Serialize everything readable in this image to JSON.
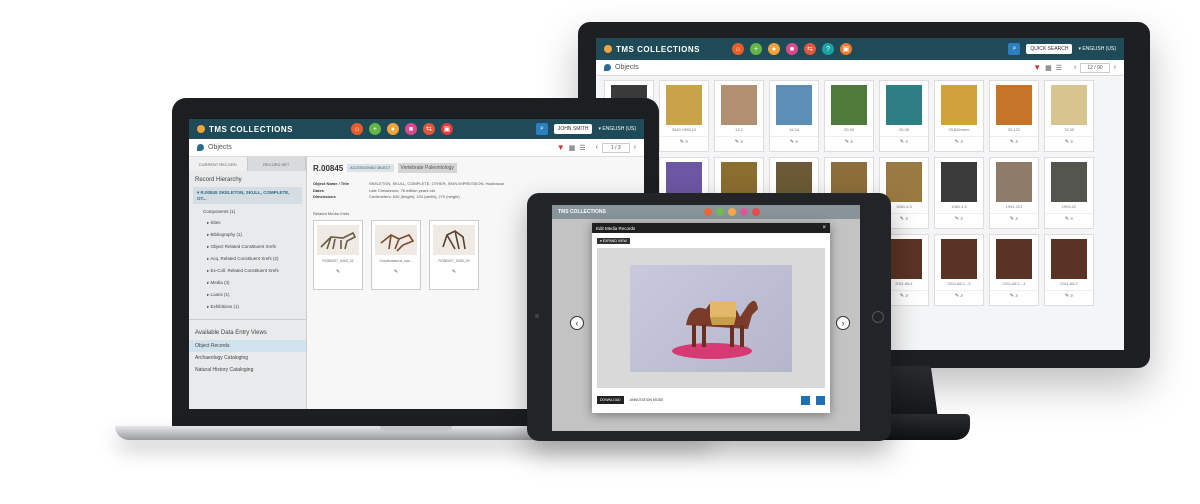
{
  "monitor": {
    "brand": "TMS COLLECTIONS",
    "user": "QUICK SEARCH",
    "lang": "▾ ENGLISH (US)",
    "page_title": "Objects",
    "pager": "12 / 90",
    "thumbs": [
      {
        "label": "",
        "color": "#3a3a3a"
      },
      {
        "label": "3040 1995.10",
        "color": "#c9a24a"
      },
      {
        "label": "13.2",
        "color": "#b09070"
      },
      {
        "label": "19.34",
        "color": "#5c8fb8"
      },
      {
        "label": "20.35",
        "color": "#4f7a3a"
      },
      {
        "label": "25.36",
        "color": "#2e7f83"
      },
      {
        "label": "29.83/mmm",
        "color": "#d1a23c"
      },
      {
        "label": "30.122",
        "color": "#c5752a"
      },
      {
        "label": "78.35",
        "color": "#d8c48e"
      },
      {
        "label": "",
        "color": "#7a4a3b"
      },
      {
        "label": "",
        "color": "#6c57a3"
      },
      {
        "label": "",
        "color": "#8a6d2f"
      },
      {
        "label": "",
        "color": "#6b5a35"
      },
      {
        "label": "1961.5",
        "color": "#8c6e3a"
      },
      {
        "label": "1981.4.3",
        "color": "#9a7a42"
      },
      {
        "label": "1981.4.5",
        "color": "#3b3b3b"
      },
      {
        "label": "1991.221",
        "color": "#8e7b6a"
      },
      {
        "label": "1994.22",
        "color": "#55554f"
      },
      {
        "label": "",
        "color": "#8f6a4a"
      },
      {
        "label": "",
        "color": "#3e3a30"
      },
      {
        "label": "",
        "color": "#576c4a"
      },
      {
        "label": "",
        "color": "#4c4b3a"
      },
      {
        "label": "2004.14",
        "color": "#6a8a56"
      },
      {
        "label": "2011.68.1",
        "color": "#5a3324"
      },
      {
        "label": "2011.68.1...3",
        "color": "#5a3324"
      },
      {
        "label": "2011.68.1...4",
        "color": "#5a3324"
      },
      {
        "label": "2011.68.2",
        "color": "#5a3324"
      }
    ]
  },
  "laptop": {
    "brand": "TMS COLLECTIONS",
    "user": "JOHN SMITH",
    "lang": "▾ ENGLISH (US)",
    "page_title": "Objects",
    "pager": "1 / 3",
    "tabs": [
      "CURRENT RECORD",
      "RECORD SET"
    ],
    "tree_head": "Record Hierarchy",
    "tree_root": "▾ R.00845 SKELETON, SKULL, COMPLETE, OT...",
    "tree_items": [
      "Components (1)",
      "▸ Sites",
      "▸ Bibliography (1)",
      "▸ Object Related Constituent Xrefs",
      "▸ Acq. Related Constituent Xrefs (2)",
      "▸ Ex-Coll. Related Constituent Xrefs",
      "▸ Media (3)",
      "▸ Loans (1)",
      "▸ Exhibitions (1)"
    ],
    "dev_head": "Available Data Entry Views",
    "dev_items": [
      "Object Records",
      "Archaeology Cataloging",
      "Natural History Cataloging"
    ],
    "record": {
      "id": "R.00845",
      "badge": "ACCESSIONED OBJECT",
      "field": "Vertebrate Paleontology",
      "rows": [
        {
          "k": "Object Name / Title",
          "v": "SKELETON, SKULL, COMPLETE, OTHER, SKIN IMPRESSION; Hadrosaur"
        },
        {
          "k": "Dates",
          "v": "Late Cretaceous, 76 million years old"
        },
        {
          "k": "Dimensions",
          "v": "Centimeters: 630 (length); 104 (width); 270 (height)"
        }
      ],
      "media_label": "Related Media Xrefs",
      "media": [
        {
          "label": "RON0007_9400_32"
        },
        {
          "label": "Corythosaurus_cas..."
        },
        {
          "label": "RON0007_9400_33"
        }
      ]
    }
  },
  "tablet": {
    "brand": "TMS COLLECTIONS",
    "modal_title": "Edit Media Records",
    "modal_tag": "▾ EXPAND VIEW",
    "download": "DOWNLOAD",
    "annotation": "ANNOTATION MODE"
  },
  "colors": {
    "header": "#1f4a58",
    "accent": "#2b7fbf",
    "nav_icons": [
      "#e85d2a",
      "#63b545",
      "#f2a33a",
      "#d94a8c",
      "#e0583b",
      "#e23c3c",
      "#1aa3a3",
      "#f17a2e"
    ]
  }
}
